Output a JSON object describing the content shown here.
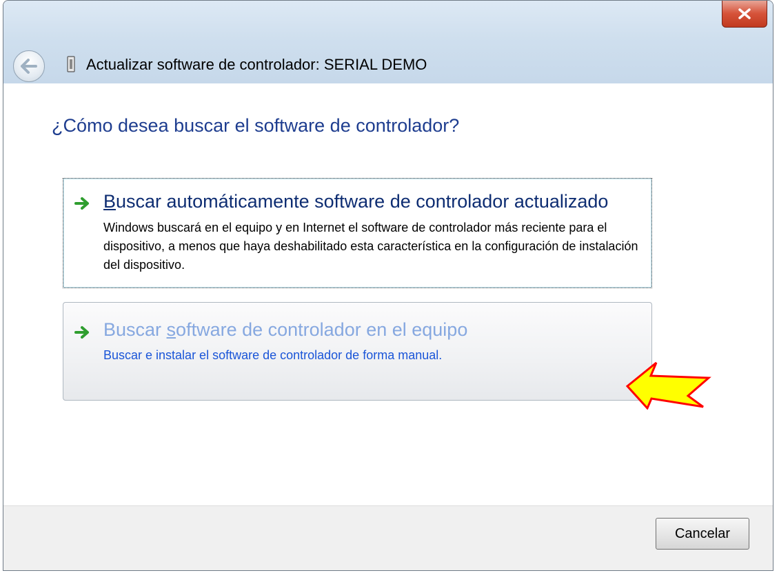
{
  "window": {
    "title": "Actualizar software de controlador: SERIAL DEMO",
    "close_icon": "close-x-icon",
    "back_icon": "back-arrow-icon",
    "device_icon": "device-connector-icon"
  },
  "main": {
    "heading": "¿Cómo desea buscar el software de controlador?",
    "options": [
      {
        "icon": "green-arrow-icon",
        "title_accel": "B",
        "title_rest": "uscar automáticamente software de controlador actualizado",
        "description": "Windows buscará en el equipo y en Internet el software de controlador más reciente para el dispositivo, a menos que haya deshabilitado esta característica en la configuración de instalación del dispositivo."
      },
      {
        "icon": "green-arrow-icon",
        "title_pre": "Buscar ",
        "title_accel": "s",
        "title_rest": "oftware de controlador en el equipo",
        "description": "Buscar e instalar el software de controlador de forma manual."
      }
    ]
  },
  "annotation": {
    "icon": "yellow-pointer-arrow",
    "fill": "#ffff00",
    "stroke": "#ff0000"
  },
  "footer": {
    "cancel_label": "Cancelar"
  },
  "colors": {
    "heading": "#1e3d8f",
    "link_hover": "#86a8e0",
    "description_blue": "#1a55d8"
  }
}
